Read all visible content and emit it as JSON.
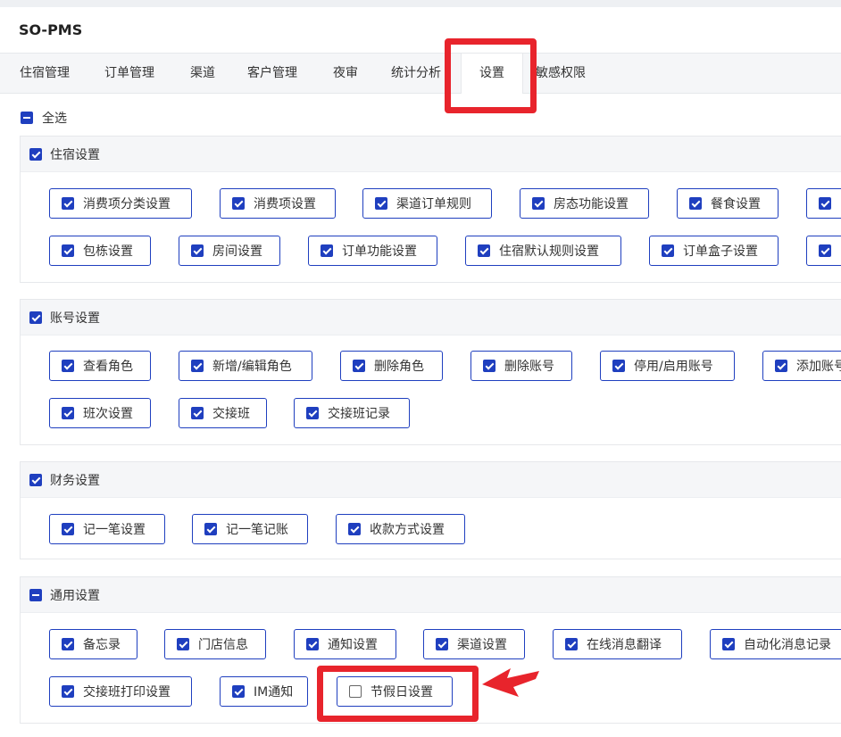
{
  "app": {
    "title": "SO-PMS"
  },
  "tabs": [
    {
      "label": "住宿管理",
      "active": false
    },
    {
      "label": "订单管理",
      "active": false
    },
    {
      "label": "渠道",
      "active": false
    },
    {
      "label": "客户管理",
      "active": false
    },
    {
      "label": "夜审",
      "active": false
    },
    {
      "label": "统计分析",
      "active": false
    },
    {
      "label": "设置",
      "active": true
    },
    {
      "label": "敏感权限",
      "active": false
    }
  ],
  "select_all": {
    "label": "全选",
    "state": "indeterminate"
  },
  "sections": [
    {
      "title": "住宿设置",
      "state": "checked",
      "items": [
        {
          "label": "消费项分类设置",
          "checked": true
        },
        {
          "label": "消费项设置",
          "checked": true
        },
        {
          "label": "渠道订单规则",
          "checked": true
        },
        {
          "label": "房态功能设置",
          "checked": true
        },
        {
          "label": "餐食设置",
          "checked": true
        },
        {
          "label": "",
          "checked": true
        },
        {
          "label": "包栋设置",
          "checked": true
        },
        {
          "label": "房间设置",
          "checked": true
        },
        {
          "label": "订单功能设置",
          "checked": true
        },
        {
          "label": "住宿默认规则设置",
          "checked": true
        },
        {
          "label": "订单盒子设置",
          "checked": true
        },
        {
          "label": "",
          "checked": true
        }
      ]
    },
    {
      "title": "账号设置",
      "state": "checked",
      "items": [
        {
          "label": "查看角色",
          "checked": true
        },
        {
          "label": "新增/编辑角色",
          "checked": true
        },
        {
          "label": "删除角色",
          "checked": true
        },
        {
          "label": "删除账号",
          "checked": true
        },
        {
          "label": "停用/启用账号",
          "checked": true
        },
        {
          "label": "添加账号",
          "checked": true
        },
        {
          "label": "班次设置",
          "checked": true
        },
        {
          "label": "交接班",
          "checked": true
        },
        {
          "label": "交接班记录",
          "checked": true
        }
      ]
    },
    {
      "title": "财务设置",
      "state": "checked",
      "items": [
        {
          "label": "记一笔设置",
          "checked": true
        },
        {
          "label": "记一笔记账",
          "checked": true
        },
        {
          "label": "收款方式设置",
          "checked": true
        }
      ]
    },
    {
      "title": "通用设置",
      "state": "indeterminate",
      "items": [
        {
          "label": "备忘录",
          "checked": true
        },
        {
          "label": "门店信息",
          "checked": true
        },
        {
          "label": "通知设置",
          "checked": true
        },
        {
          "label": "渠道设置",
          "checked": true
        },
        {
          "label": "在线消息翻译",
          "checked": true
        },
        {
          "label": "自动化消息记录",
          "checked": true
        },
        {
          "label": "交接班打印设置",
          "checked": true
        },
        {
          "label": "IM通知",
          "checked": true
        },
        {
          "label": "节假日设置",
          "checked": false
        }
      ]
    }
  ],
  "annotation_color": "#e8242c",
  "accent_color": "#1f3fbf"
}
